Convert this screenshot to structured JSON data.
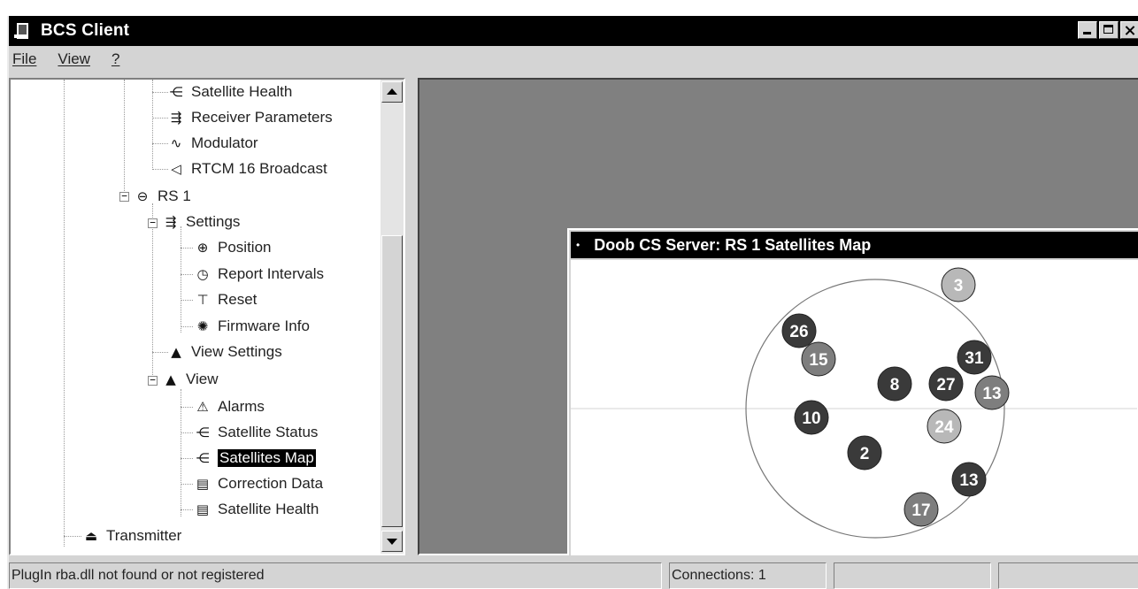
{
  "window": {
    "title": "BCS Client"
  },
  "menu": [
    "File",
    "View",
    "?"
  ],
  "tree": {
    "items": [
      {
        "label": "Satellite Health",
        "icon": "satellite-icon"
      },
      {
        "label": "Receiver Parameters",
        "icon": "receiver-icon"
      },
      {
        "label": "Modulator",
        "icon": "modulator-icon"
      },
      {
        "label": "RTCM 16 Broadcast",
        "icon": "speaker-icon"
      },
      {
        "label": "RS 1",
        "icon": "station-icon"
      },
      {
        "label": "Settings",
        "icon": "receiver-icon"
      },
      {
        "label": "Position",
        "icon": "position-icon"
      },
      {
        "label": "Report Intervals",
        "icon": "clock-icon"
      },
      {
        "label": "Reset",
        "icon": "hammer-icon"
      },
      {
        "label": "Firmware Info",
        "icon": "gear-icon"
      },
      {
        "label": "View Settings",
        "icon": "binoculars-icon"
      },
      {
        "label": "View",
        "icon": "binoculars-icon"
      },
      {
        "label": "Alarms",
        "icon": "alarm-icon"
      },
      {
        "label": "Satellite Status",
        "icon": "satellite-icon"
      },
      {
        "label": "Satellites Map",
        "icon": "satellite-icon"
      },
      {
        "label": "Correction Data",
        "icon": "document-icon"
      },
      {
        "label": "Satellite Health",
        "icon": "document-icon"
      },
      {
        "label": "Transmitter",
        "icon": "transmitter-icon"
      }
    ],
    "selected": "Satellites Map"
  },
  "child_window": {
    "title": "Doob CS Server: RS 1 Satellites Map"
  },
  "satellites": [
    {
      "id": "3",
      "shade": "light"
    },
    {
      "id": "26",
      "shade": "dark"
    },
    {
      "id": "15",
      "shade": "medium"
    },
    {
      "id": "31",
      "shade": "dark"
    },
    {
      "id": "8",
      "shade": "dark"
    },
    {
      "id": "27",
      "shade": "dark"
    },
    {
      "id": "13",
      "shade": "medium"
    },
    {
      "id": "10",
      "shade": "dark"
    },
    {
      "id": "24",
      "shade": "light"
    },
    {
      "id": "2",
      "shade": "dark"
    },
    {
      "id": "13",
      "shade": "dark"
    },
    {
      "id": "17",
      "shade": "medium"
    }
  ],
  "colors": {
    "dark": "#3a3a3a",
    "medium": "#7e7e7e",
    "light": "#b8b8b8"
  },
  "status": {
    "message": "PlugIn rba.dll not found or not registered",
    "connections": "Connections: 1"
  }
}
